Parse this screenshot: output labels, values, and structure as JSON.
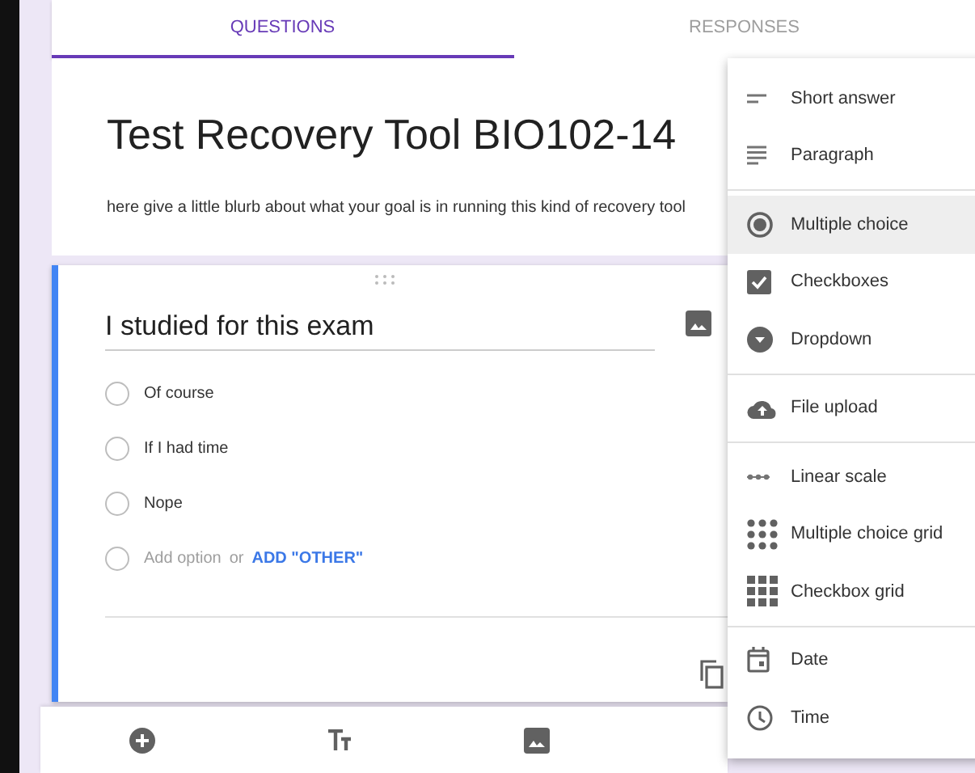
{
  "tabs": [
    {
      "label": "QUESTIONS",
      "selected": true
    },
    {
      "label": "RESPONSES",
      "selected": false
    }
  ],
  "header": {
    "title": "Test Recovery Tool BIO102-14",
    "description": "here give a little blurb about what your goal is in running this kind of recovery tool"
  },
  "question": {
    "title": "I studied for this exam",
    "options": [
      "Of course",
      "If I had time",
      "Nope"
    ],
    "add_option": "Add option",
    "or": "or",
    "add_other": "ADD \"OTHER\""
  },
  "menu": [
    [
      {
        "kind": "short",
        "label": "Short answer",
        "selected": false
      },
      {
        "kind": "paragraph",
        "label": "Paragraph",
        "selected": false
      }
    ],
    [
      {
        "kind": "radio",
        "label": "Multiple choice",
        "selected": true
      },
      {
        "kind": "checkbox",
        "label": "Checkboxes",
        "selected": false
      },
      {
        "kind": "dropdown",
        "label": "Dropdown",
        "selected": false
      }
    ],
    [
      {
        "kind": "upload",
        "label": "File upload",
        "selected": false
      }
    ],
    [
      {
        "kind": "scale",
        "label": "Linear scale",
        "selected": false
      },
      {
        "kind": "dotgrid",
        "label": "Multiple choice grid",
        "selected": false
      },
      {
        "kind": "squaregrid",
        "label": "Checkbox grid",
        "selected": false
      }
    ],
    [
      {
        "kind": "date",
        "label": "Date",
        "selected": false
      },
      {
        "kind": "time",
        "label": "Time",
        "selected": false
      }
    ]
  ]
}
